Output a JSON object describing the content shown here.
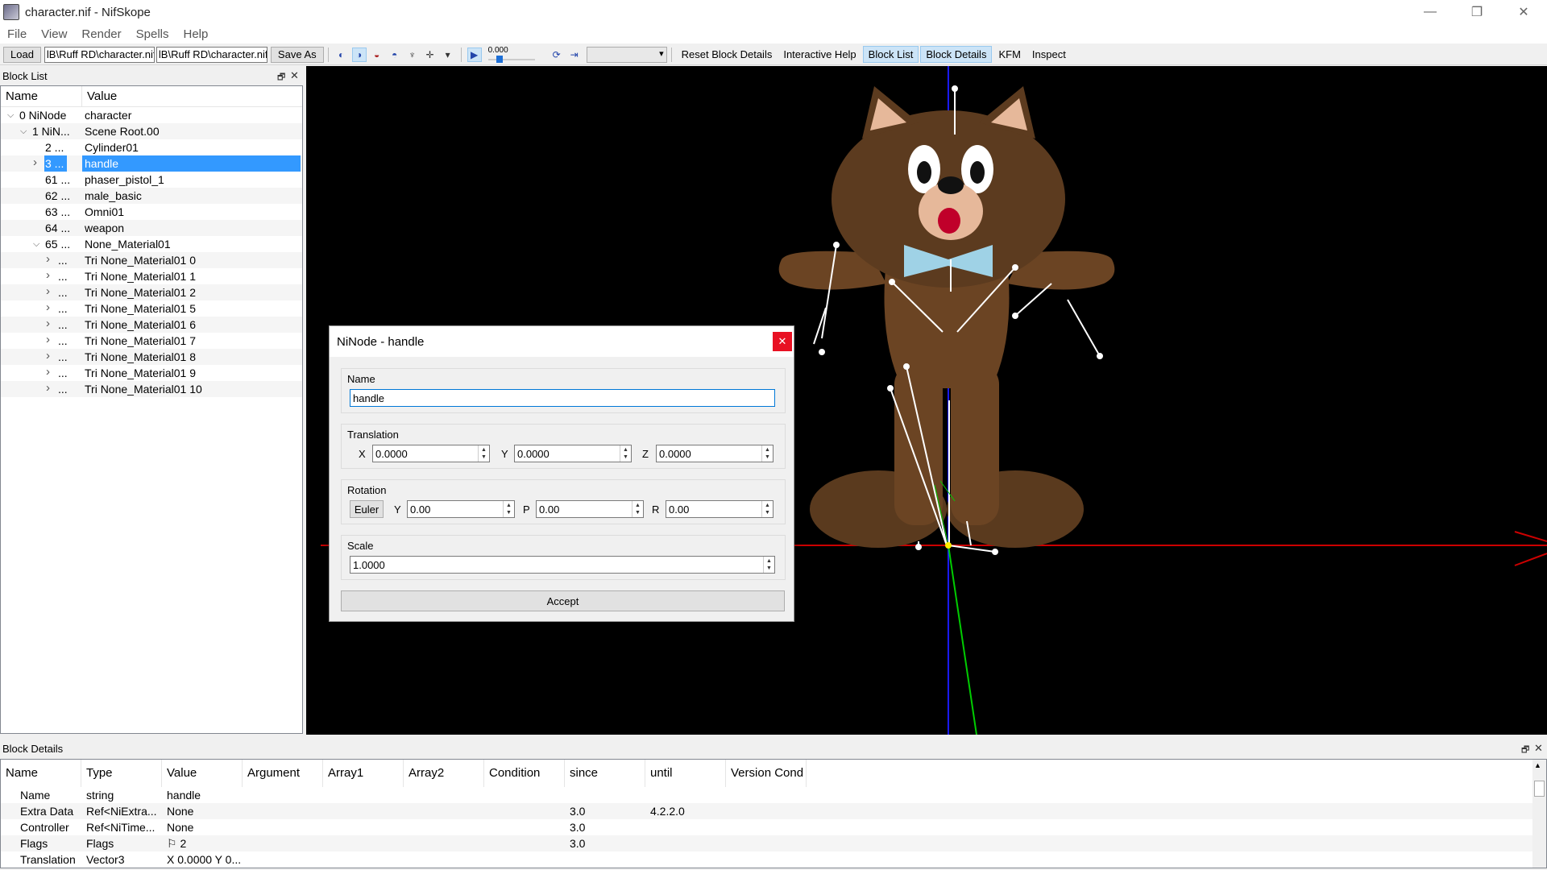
{
  "window": {
    "title": "character.nif - NifSkope",
    "minimize": "—",
    "restore": "❐",
    "close": "✕"
  },
  "menu": [
    "File",
    "View",
    "Render",
    "Spells",
    "Help"
  ],
  "toolbar": {
    "load": "Load",
    "load_path": "lB\\Ruff RD\\character.nif",
    "save_path": "lB\\Ruff RD\\character.nif",
    "save_as": "Save As",
    "time_value": "0.000",
    "reset_block_details": "Reset Block Details",
    "interactive_help": "Interactive Help",
    "block_list": "Block List",
    "block_details": "Block Details",
    "kfm": "KFM",
    "inspect": "Inspect"
  },
  "block_list": {
    "title": "Block List",
    "columns": [
      "Name",
      "Value"
    ],
    "rows": [
      {
        "name": "0 NiNode",
        "value": "character",
        "indent": 0,
        "arrow": "v"
      },
      {
        "name": "1 NiN...",
        "value": "Scene Root.00",
        "indent": 1,
        "arrow": "v"
      },
      {
        "name": "2 ...",
        "value": "Cylinder01",
        "indent": 2,
        "arrow": ""
      },
      {
        "name": "3 ...",
        "value": "handle",
        "indent": 2,
        "arrow": ">",
        "selected": true
      },
      {
        "name": "61 ...",
        "value": "phaser_pistol_1",
        "indent": 2,
        "arrow": ""
      },
      {
        "name": "62 ...",
        "value": "male_basic",
        "indent": 2,
        "arrow": ""
      },
      {
        "name": "63 ...",
        "value": "Omni01",
        "indent": 2,
        "arrow": ""
      },
      {
        "name": "64 ...",
        "value": "weapon",
        "indent": 2,
        "arrow": ""
      },
      {
        "name": "65 ...",
        "value": "None_Material01",
        "indent": 2,
        "arrow": "v"
      },
      {
        "name": "...",
        "value": "Tri None_Material01 0",
        "indent": 3,
        "arrow": ">"
      },
      {
        "name": "...",
        "value": "Tri None_Material01 1",
        "indent": 3,
        "arrow": ">"
      },
      {
        "name": "...",
        "value": "Tri None_Material01 2",
        "indent": 3,
        "arrow": ">"
      },
      {
        "name": "...",
        "value": "Tri None_Material01 5",
        "indent": 3,
        "arrow": ">"
      },
      {
        "name": "...",
        "value": "Tri None_Material01 6",
        "indent": 3,
        "arrow": ">"
      },
      {
        "name": "...",
        "value": "Tri None_Material01 7",
        "indent": 3,
        "arrow": ">"
      },
      {
        "name": "...",
        "value": "Tri None_Material01 8",
        "indent": 3,
        "arrow": ">"
      },
      {
        "name": "...",
        "value": "Tri None_Material01 9",
        "indent": 3,
        "arrow": ">"
      },
      {
        "name": "...",
        "value": "Tri None_Material01 10",
        "indent": 3,
        "arrow": ">"
      }
    ]
  },
  "dialog": {
    "title": "NiNode - handle",
    "name_group": "Name",
    "name_value": "handle",
    "translation_group": "Translation",
    "tx_label": "X",
    "tx": "0.0000",
    "ty_label": "Y",
    "ty": "0.0000",
    "tz_label": "Z",
    "tz": "0.0000",
    "rotation_group": "Rotation",
    "euler": "Euler",
    "ry_label": "Y",
    "ry": "0.00",
    "rp_label": "P",
    "rp": "0.00",
    "rr_label": "R",
    "rr": "0.00",
    "scale_group": "Scale",
    "scale": "1.0000",
    "accept": "Accept"
  },
  "block_details": {
    "title": "Block Details",
    "columns": [
      "Name",
      "Type",
      "Value",
      "Argument",
      "Array1",
      "Array2",
      "Condition",
      "since",
      "until",
      "Version Cond"
    ],
    "rows": [
      {
        "name": "Name",
        "type": "string",
        "value": "handle",
        "since": "",
        "until": ""
      },
      {
        "name": "Extra Data",
        "type": "Ref<NiExtra...",
        "value": "None",
        "since": "3.0",
        "until": "4.2.2.0"
      },
      {
        "name": "Controller",
        "type": "Ref<NiTime...",
        "value": "None",
        "since": "3.0",
        "until": ""
      },
      {
        "name": "Flags",
        "type": "Flags",
        "value": "⚐ 2",
        "since": "3.0",
        "until": ""
      },
      {
        "name": "Translation",
        "type": "Vector3",
        "value": "X 0.0000 Y 0...",
        "since": "",
        "until": ""
      }
    ]
  },
  "colors": {
    "selection": "#3399ff",
    "viewport_bg": "#000000",
    "axis_x": "#cc0000",
    "axis_y": "#00cc00",
    "axis_z": "#1a1aff",
    "character_brown": "#5a3a1e",
    "bowtie": "#9fd2e6"
  }
}
